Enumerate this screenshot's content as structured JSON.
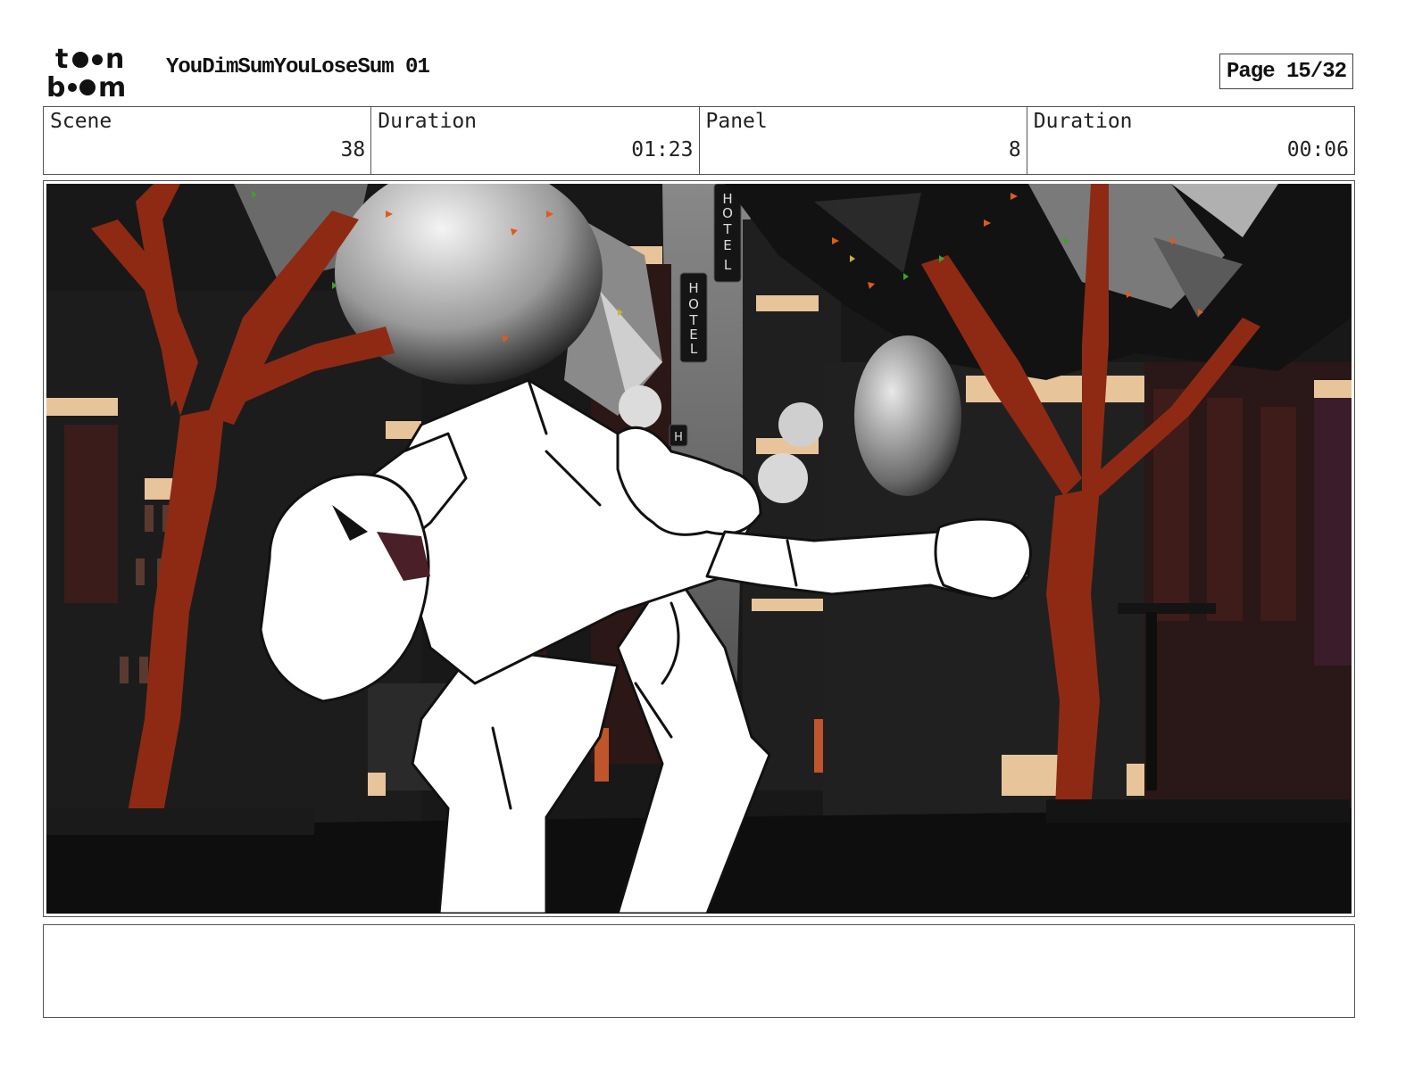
{
  "header": {
    "logo_text": "toon boom",
    "project_title": "YouDimSumYouLoseSum 01",
    "page_label": "Page 15/32"
  },
  "info": {
    "scene_label": "Scene",
    "scene_value": "38",
    "scene_duration_label": "Duration",
    "scene_duration_value": "01:23",
    "panel_label": "Panel",
    "panel_value": "8",
    "panel_duration_label": "Duration",
    "panel_duration_value": "00:06"
  },
  "panel": {
    "signs": [
      "HOTEL",
      "HOTEL",
      "H"
    ]
  },
  "notes": {
    "text": ""
  },
  "colors": {
    "trunk": "#8e2a14",
    "sky": "#6e6e6e",
    "ground": "#0e0e0e",
    "building": "#1e1e1e",
    "window_trim": "#e8c49a"
  }
}
